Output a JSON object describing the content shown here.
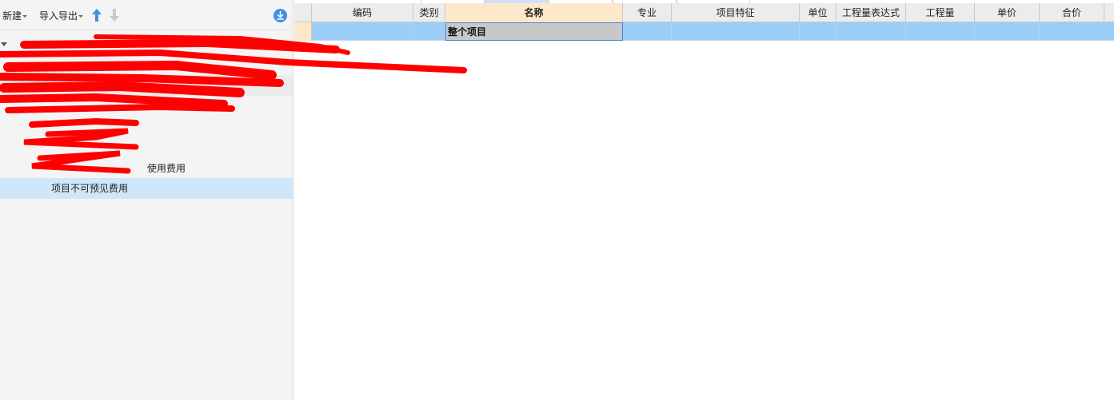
{
  "toolbar": {
    "new_label": "新建",
    "import_export_label": "导入导出",
    "move_up_icon": "arrow-up-icon",
    "move_down_icon": "arrow-down-icon",
    "download_icon": "download-circle-icon"
  },
  "tree": {
    "items": [
      {
        "label": "",
        "redacted": true
      },
      {
        "label": "",
        "redacted": true
      },
      {
        "label": "",
        "redacted": true
      },
      {
        "label": "",
        "redacted": true
      },
      {
        "label": "",
        "redacted": true
      },
      {
        "label": "",
        "redacted": true
      },
      {
        "label": "使用费用",
        "redacted": true
      },
      {
        "label": "项目不可预见费用",
        "redacted": false,
        "selected": true
      }
    ]
  },
  "grid": {
    "columns": [
      {
        "key": "rowhead",
        "label": ""
      },
      {
        "key": "code",
        "label": "编码"
      },
      {
        "key": "category",
        "label": "类别"
      },
      {
        "key": "name",
        "label": "名称"
      },
      {
        "key": "specialty",
        "label": "专业"
      },
      {
        "key": "features",
        "label": "项目特征"
      },
      {
        "key": "unit",
        "label": "单位"
      },
      {
        "key": "expr",
        "label": "工程量表达式"
      },
      {
        "key": "qty",
        "label": "工程量"
      },
      {
        "key": "price",
        "label": "单价"
      },
      {
        "key": "total",
        "label": "合价"
      }
    ],
    "rows": [
      {
        "code": "",
        "category": "",
        "name": "整个项目",
        "specialty": "",
        "features": "",
        "unit": "",
        "expr": "",
        "qty": "",
        "price": "",
        "total": ""
      }
    ]
  },
  "colors": {
    "accent": "#3f8fe5",
    "selected_row": "#9ccdf4",
    "active_header": "#fde8cc",
    "tree_selected": "#cfe6fb",
    "redaction": "#ff0000"
  }
}
